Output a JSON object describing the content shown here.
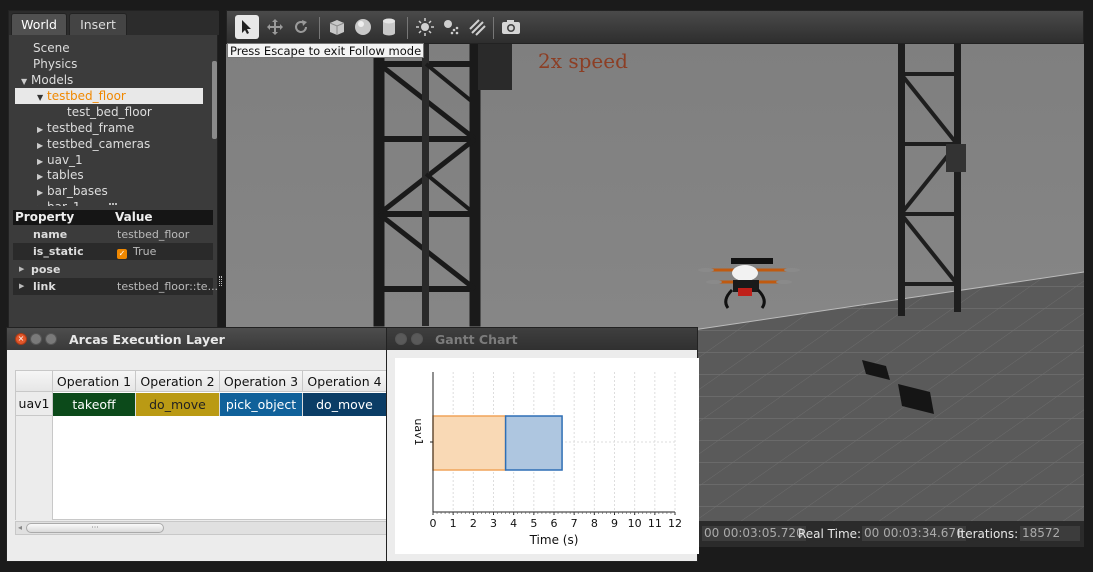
{
  "left_panel": {
    "tabs": [
      "World",
      "Insert"
    ],
    "tree": {
      "scene": "Scene",
      "physics": "Physics",
      "models": "Models",
      "testbed_floor": "testbed_floor",
      "test_bed_floor": "test_bed_floor",
      "testbed_frame": "testbed_frame",
      "testbed_cameras": "testbed_cameras",
      "uav_1": "uav_1",
      "tables": "tables",
      "bar_bases": "bar_bases",
      "bar_1_partial": "bar_1"
    },
    "property_header": {
      "property": "Property",
      "value": "Value"
    },
    "properties": {
      "name_key": "name",
      "name_value": "testbed_floor",
      "static_key": "is_static",
      "static_value": "True",
      "pose_key": "pose",
      "link_key": "link",
      "link_value": "testbed_floor::te..."
    }
  },
  "toolbar": {
    "tools": [
      "select-arrow-icon",
      "translate-icon",
      "rotate-icon",
      "box-icon",
      "sphere-icon",
      "cylinder-icon",
      "point-light-icon",
      "spot-light-icon",
      "directional-light-icon",
      "camera-screenshot-icon"
    ]
  },
  "viewport": {
    "tooltip": "Press Escape to exit Follow mode",
    "speed_label": "2x speed"
  },
  "status": {
    "sim_time_value": "00 00:03:05.720",
    "real_time_label": "Real Time:",
    "real_time_value": "00 00:03:34.676",
    "iterations_label": "Iterations:",
    "iterations_value": "18572"
  },
  "arcas_window": {
    "title": "Arcas Execution Layer",
    "columns": [
      "Operation 1",
      "Operation 2",
      "Operation 3",
      "Operation 4"
    ],
    "row_label": "uav1",
    "cells": [
      "takeoff",
      "do_move",
      "pick_object",
      "do_move"
    ],
    "cell_colors": [
      "#0c4a1a",
      "#ba9a14",
      "#10619a",
      "#0b3d66"
    ]
  },
  "gantt_window": {
    "title": "Gantt Chart"
  },
  "chart_data": {
    "type": "bar",
    "title": "",
    "xlabel": "Time (s)",
    "ylabel": "",
    "categories": [
      "uav1"
    ],
    "xlim": [
      0,
      12
    ],
    "xticks": [
      "0",
      "1",
      "2",
      "3",
      "4",
      "5",
      "6",
      "7",
      "8",
      "9",
      "10",
      "11",
      "12"
    ],
    "ytick_label": "uav1",
    "grid": true,
    "segments": [
      {
        "start": 0,
        "end": 3.6,
        "color": "#f9d9b5",
        "edge": "#f0a45a"
      },
      {
        "start": 3.6,
        "end": 6.4,
        "color": "#aec6e0",
        "edge": "#2f6fb5"
      }
    ]
  }
}
